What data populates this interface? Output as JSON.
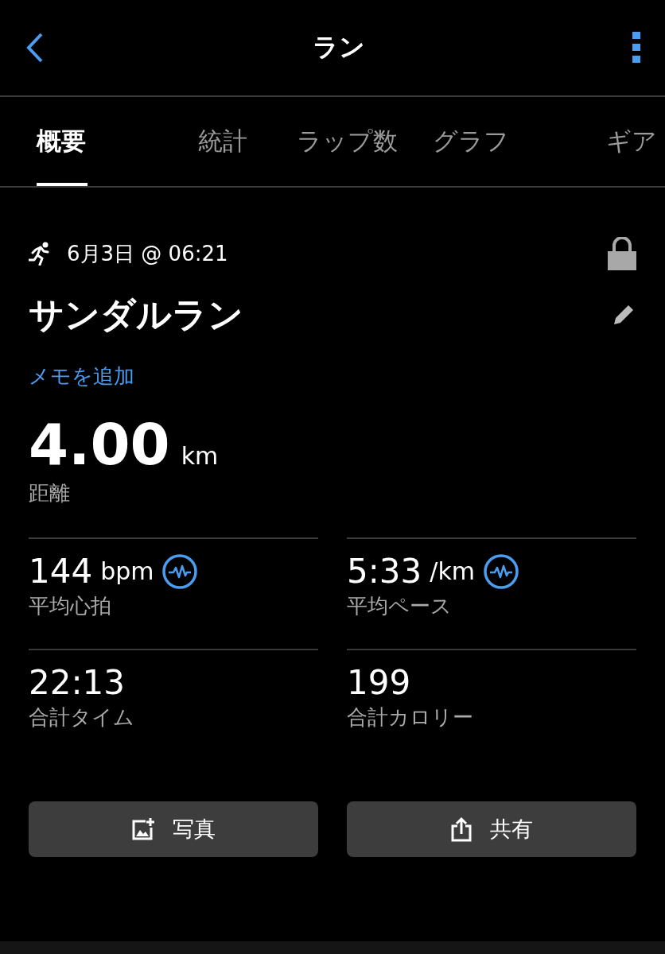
{
  "header": {
    "title": "ラン"
  },
  "tabs": [
    {
      "label": "概要",
      "selected": true
    },
    {
      "label": "統計",
      "selected": false
    },
    {
      "label": "ラップ数",
      "selected": false
    },
    {
      "label": "グラフ",
      "selected": false
    },
    {
      "label": "ギア",
      "selected": false
    }
  ],
  "activity": {
    "datetime": "6月3日 @ 06:21",
    "locked": true,
    "name": "サンダルラン",
    "add_note": "メモを追加"
  },
  "distance": {
    "value": "4.00",
    "unit": "km",
    "label": "距離"
  },
  "stats": [
    {
      "value": "144",
      "unit": "bpm",
      "label": "平均心拍",
      "chart": true
    },
    {
      "value": "5:33",
      "unit": "/km",
      "label": "平均ペース",
      "chart": true
    },
    {
      "value": "22:13",
      "label": "合計タイム",
      "chart": false
    },
    {
      "value": "199",
      "label": "合計カロリー",
      "chart": false
    }
  ],
  "buttons": [
    {
      "kind": "photo",
      "label": "写真"
    },
    {
      "kind": "share",
      "label": "共有"
    }
  ]
}
